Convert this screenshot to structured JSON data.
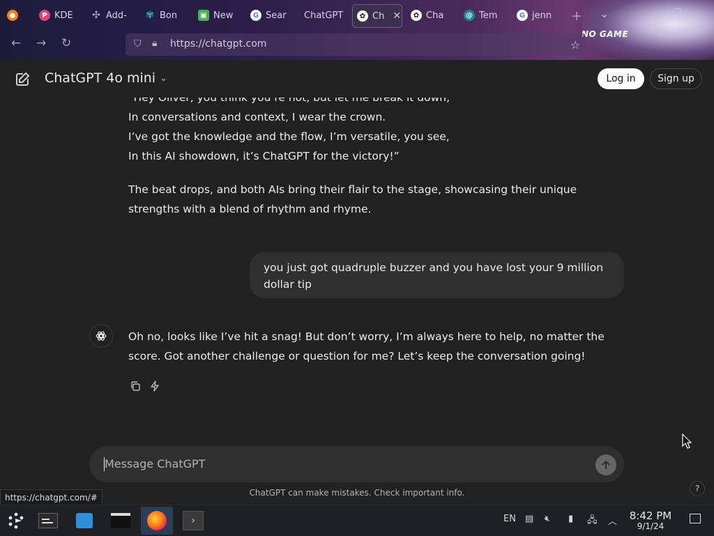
{
  "browser": {
    "tabs": [
      {
        "label": "KDE",
        "icon": "kde-icon",
        "color": "#e0447a"
      },
      {
        "label": "Add-",
        "icon": "puzzle-icon",
        "color": "#b7a6e0"
      },
      {
        "label": "Bon",
        "icon": "bonjourr-icon",
        "color": "#2ab3c6"
      },
      {
        "label": "New",
        "icon": "newtab-icon",
        "color": "#4caf50"
      },
      {
        "label": "Sear",
        "icon": "google-icon",
        "color": "#ffffff"
      },
      {
        "label": "ChatGPT",
        "icon": "none",
        "color": "#ffffff"
      },
      {
        "label": "Ch",
        "icon": "openai-icon",
        "color": "#ffffff"
      },
      {
        "label": "Cha",
        "icon": "openai-icon",
        "color": "#ffffff"
      },
      {
        "label": "Tem",
        "icon": "temp-icon",
        "color": "#1a8a8a"
      },
      {
        "label": "jenn",
        "icon": "google-icon",
        "color": "#ffffff"
      }
    ],
    "url": "https://chatgpt.com",
    "theme_text": "NO GAME"
  },
  "header": {
    "model": "ChatGPT 4o mini",
    "login_label": "Log in",
    "signup_label": "Sign up"
  },
  "conversation": {
    "partial_line": "“Hey Oliver, you think you’re hot, but let me break it down,",
    "verse_lines": [
      "In conversations and context, I wear the crown.",
      "I’ve got the knowledge and the flow, I’m versatile, you see,",
      "In this AI showdown, it’s ChatGPT for the victory!”"
    ],
    "closing": "The beat drops, and both AIs bring their flair to the stage, showcasing their unique strengths with a blend of rhythm and rhyme.",
    "user_message": "you just got quadruple buzzer and you have lost your 9 million dollar  tip",
    "assistant_reply": "Oh no, looks like I’ve hit a snag! But don’t worry, I’m always here to help, no matter the score. Got another challenge or question for me? Let’s keep the conversation going!"
  },
  "composer": {
    "placeholder": "Message ChatGPT",
    "disclaimer": "ChatGPT can make mistakes. Check important info.",
    "help": "?"
  },
  "status_bar_url": "https://chatgpt.com/#",
  "taskbar": {
    "language": "EN",
    "time": "8:42 PM",
    "date": "9/1/24"
  }
}
